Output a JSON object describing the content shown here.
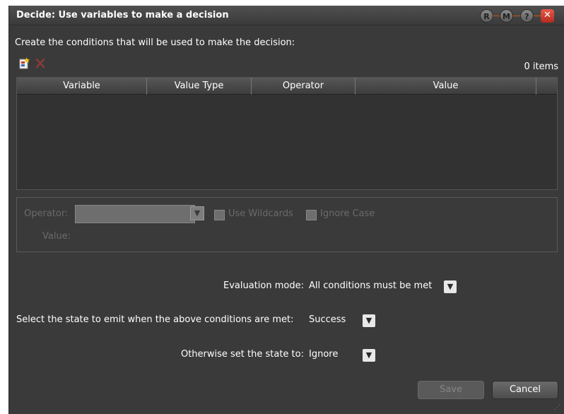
{
  "window": {
    "title": "Decide: Use variables to make a decision",
    "title_buttons": [
      "R",
      "M",
      "?"
    ],
    "close_glyph": "✕"
  },
  "intro_text": "Create the conditions that will be used to make the decision:",
  "toolbar": {
    "add_icon": "add-condition-icon",
    "remove_icon": "remove-condition-icon"
  },
  "items_count": "0 items",
  "grid": {
    "columns": [
      "Variable",
      "Value Type",
      "Operator",
      "Value"
    ],
    "rows": []
  },
  "condition_editor": {
    "operator_label": "Operator:",
    "value_label": "Value:",
    "use_wildcards_label": "Use Wildcards",
    "ignore_case_label": "Ignore Case"
  },
  "evaluation": {
    "label": "Evaluation mode:",
    "value": "All conditions must be met"
  },
  "emit_state": {
    "label": "Select the state to emit when the above conditions are met:",
    "value": "Success"
  },
  "otherwise_state": {
    "label": "Otherwise set the state to:",
    "value": "Ignore"
  },
  "buttons": {
    "save": "Save",
    "cancel": "Cancel"
  },
  "colors": {
    "window_bg": "#3a3a3a",
    "grid_bg": "#323232",
    "close_red": "#d9432f",
    "accent_line": "#d35400"
  }
}
